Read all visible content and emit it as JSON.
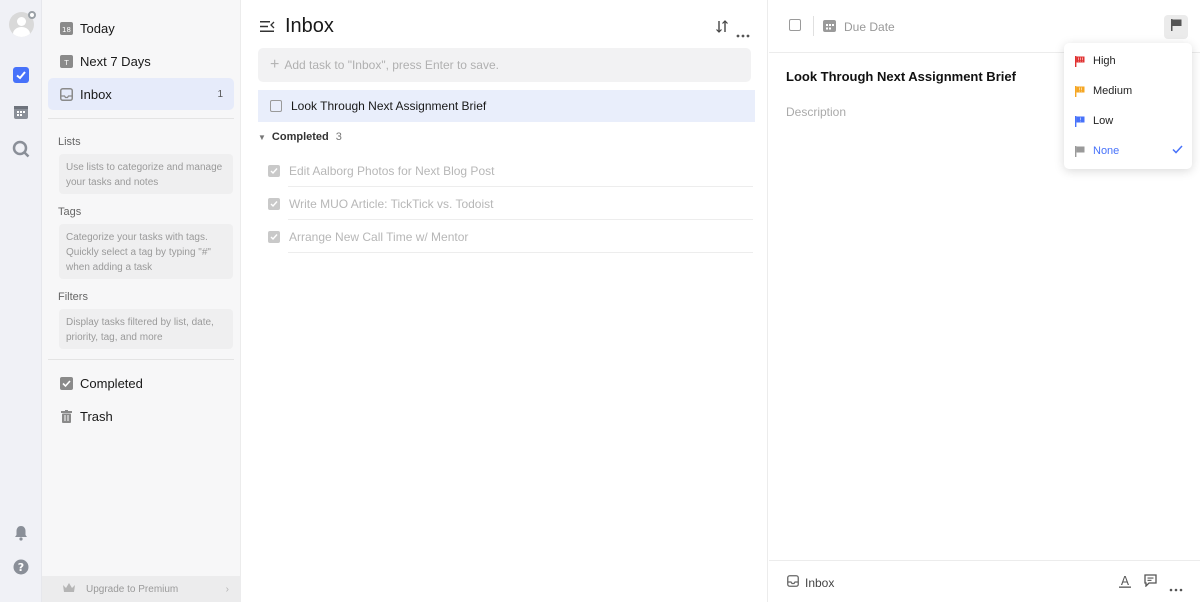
{
  "rail": {
    "icons": [
      "avatar",
      "tasks-icon",
      "calendar-icon",
      "search-icon",
      "bell-icon",
      "help-icon"
    ]
  },
  "sidebar": {
    "nav": [
      {
        "label": "Today",
        "icon": "calendar-18-icon",
        "day": "18"
      },
      {
        "label": "Next 7 Days",
        "icon": "calendar-7-icon",
        "day": "T"
      },
      {
        "label": "Inbox",
        "icon": "inbox-icon",
        "count": "1"
      }
    ],
    "lists": {
      "title": "Lists",
      "hint": "Use lists to categorize and manage your tasks and notes"
    },
    "tags": {
      "title": "Tags",
      "hint": "Categorize your tasks with tags. Quickly select a tag by typing \"#\" when adding a task"
    },
    "filters": {
      "title": "Filters",
      "hint": "Display tasks filtered by list, date, priority, tag, and more"
    },
    "bottom": [
      {
        "label": "Completed",
        "icon": "completed-icon"
      },
      {
        "label": "Trash",
        "icon": "trash-icon"
      }
    ],
    "premium": "Upgrade to Premium"
  },
  "main": {
    "title": "Inbox",
    "add_placeholder": "Add task to \"Inbox\", press Enter to save.",
    "tasks": [
      "Look Through Next Assignment Brief"
    ],
    "completed": {
      "label": "Completed",
      "count": "3",
      "items": [
        "Edit Aalborg Photos for Next Blog Post",
        "Write MUO Article: TickTick vs. Todoist",
        "Arrange New Call Time w/ Mentor"
      ]
    }
  },
  "detail": {
    "due_label": "Due Date",
    "title": "Look Through Next Assignment Brief",
    "description_placeholder": "Description",
    "list_name": "Inbox"
  },
  "priority": {
    "options": [
      {
        "label": "High",
        "color": "#e03131"
      },
      {
        "label": "Medium",
        "color": "#f5a623"
      },
      {
        "label": "Low",
        "color": "#4772fa"
      },
      {
        "label": "None",
        "color": "#9a9a9a"
      }
    ],
    "selected": "None"
  },
  "colors": {
    "accent": "#4772fa",
    "active_bg": "#e6ebfa"
  }
}
